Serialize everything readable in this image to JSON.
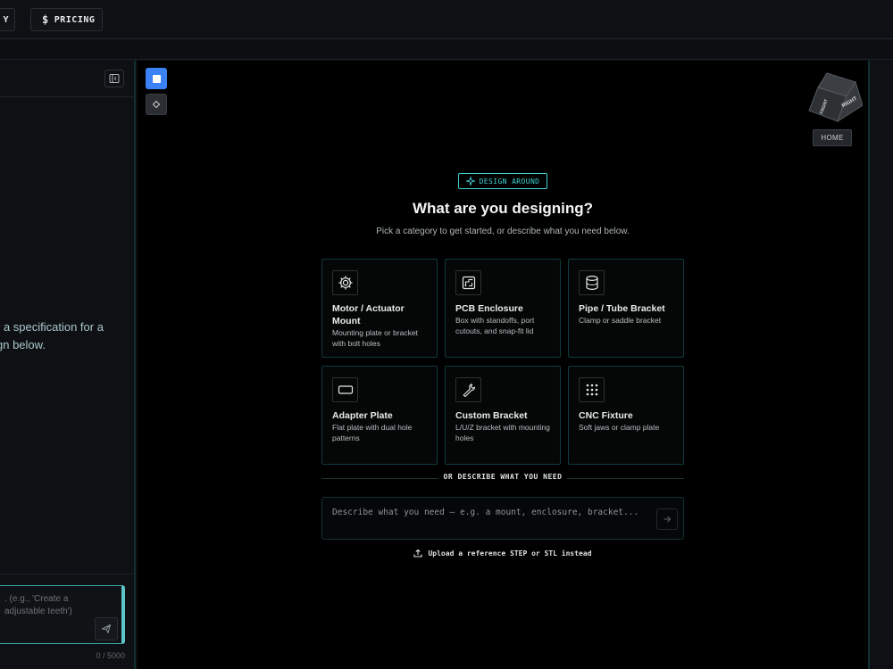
{
  "topbar": {
    "partial_button_label": "Y",
    "pricing_label": "PRICING"
  },
  "left_panel": {
    "message_lines": [
      "r a specification for a",
      "gn below."
    ],
    "input_placeholder_lines": [
      ". (e.g., 'Create a",
      "adjustable teeth')"
    ],
    "char_counter": "0 / 5000"
  },
  "viewer": {
    "home_label": "HOME",
    "cube_faces": [
      "RIGHT",
      "FRONT"
    ]
  },
  "main": {
    "badge": "DESIGN AROUND",
    "headline": "What are you designing?",
    "subline": "Pick a category to get started, or describe what you need below.",
    "categories": [
      {
        "title": "Motor / Actuator Mount",
        "desc": "Mounting plate or bracket with bolt holes",
        "icon": "gear-icon"
      },
      {
        "title": "PCB Enclosure",
        "desc": "Box with standoffs, port cutouts, and snap-fit lid",
        "icon": "circuit-board-icon"
      },
      {
        "title": "Pipe / Tube Bracket",
        "desc": "Clamp or saddle bracket",
        "icon": "cylinder-icon"
      },
      {
        "title": "Adapter Plate",
        "desc": "Flat plate with dual hole patterns",
        "icon": "rectangle-icon"
      },
      {
        "title": "Custom Bracket",
        "desc": "L/U/Z bracket with mounting holes",
        "icon": "wrench-icon"
      },
      {
        "title": "CNC Fixture",
        "desc": "Soft jaws or clamp plate",
        "icon": "grid-dots-icon"
      }
    ],
    "divider_label": "OR DESCRIBE WHAT YOU NEED",
    "describe_placeholder": "Describe what you need — e.g. a mount, enclosure, bracket...",
    "upload_label": "Upload a reference STEP or STL instead"
  },
  "colors": {
    "accent": "#3fd0d0",
    "primary_button": "#3b82f6",
    "card_border": "#0f3a3c"
  }
}
